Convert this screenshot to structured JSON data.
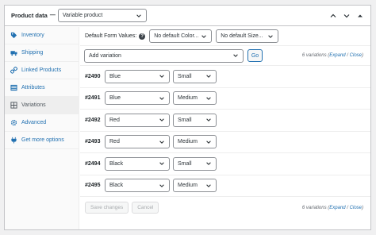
{
  "header": {
    "title": "Product data",
    "separator": "—",
    "product_type": "Variable product"
  },
  "sidebar": {
    "items": [
      {
        "label": "Inventory",
        "icon": "tag-icon"
      },
      {
        "label": "Shipping",
        "icon": "truck-icon"
      },
      {
        "label": "Linked Products",
        "icon": "link-icon"
      },
      {
        "label": "Attributes",
        "icon": "list-icon"
      },
      {
        "label": "Variations",
        "icon": "grid-icon",
        "active": true
      },
      {
        "label": "Advanced",
        "icon": "gear-icon"
      },
      {
        "label": "Get more options",
        "icon": "plugin-icon"
      }
    ]
  },
  "defaults": {
    "label": "Default Form Values:",
    "help": "?",
    "color_placeholder": "No default Color...",
    "size_placeholder": "No default Size..."
  },
  "add": {
    "select": "Add variation",
    "go": "Go"
  },
  "counter": {
    "text": "6 variations",
    "open": "(",
    "expand": "Expand",
    "sep": " / ",
    "close": "Close",
    "end": ")"
  },
  "variations": [
    {
      "id": "#2490",
      "color": "Blue",
      "size": "Small"
    },
    {
      "id": "#2491",
      "color": "Blue",
      "size": "Medium"
    },
    {
      "id": "#2492",
      "color": "Red",
      "size": "Small"
    },
    {
      "id": "#2493",
      "color": "Red",
      "size": "Medium"
    },
    {
      "id": "#2494",
      "color": "Black",
      "size": "Small"
    },
    {
      "id": "#2495",
      "color": "Black",
      "size": "Medium"
    }
  ],
  "footer": {
    "save": "Save changes",
    "cancel": "Cancel"
  }
}
